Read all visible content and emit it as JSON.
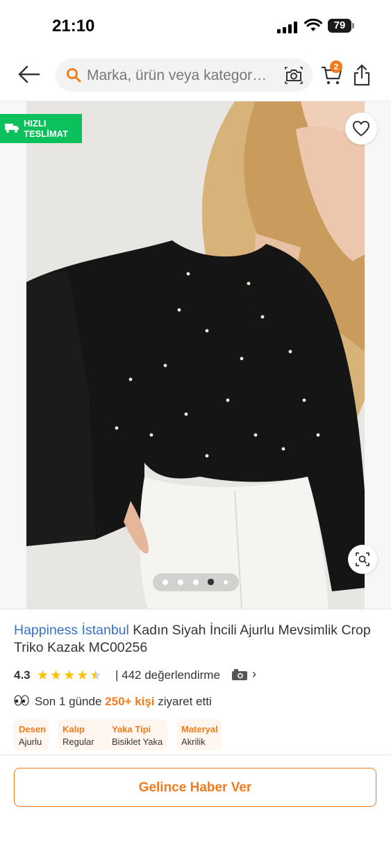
{
  "status_bar": {
    "time": "21:10",
    "battery": "79"
  },
  "nav": {
    "search_placeholder": "Marka, ürün veya kategor…",
    "cart_count": "2"
  },
  "hero": {
    "fast_delivery_badge": "HIZLI TESLİMAT",
    "gallery_index": 4,
    "gallery_total": 5
  },
  "product": {
    "brand": "Happiness İstanbul",
    "name": " Kadın Siyah İncili Ajurlu Mevsimlik Crop Triko Kazak MC00256",
    "rating": "4.3",
    "rating_value": 4.3,
    "reviews": "| 442 değerlendirme",
    "visits_prefix": "Son 1 günde ",
    "visits_highlight": "250+ kişi",
    "visits_suffix": " ziyaret etti"
  },
  "attributes": [
    {
      "key": "Desen",
      "value": "Ajurlu"
    },
    {
      "key": "Kalıp",
      "value": "Regular"
    },
    {
      "key": "Yaka Tipi",
      "value": "Bisiklet Yaka"
    },
    {
      "key": "Materyal",
      "value": "Akrilik"
    }
  ],
  "cta": {
    "label": "Gelince Haber Ver"
  },
  "colors": {
    "accent": "#f27a1a",
    "brand_link": "#3a6fc8",
    "badge_green": "#0bc15c",
    "star": "#ffc000"
  },
  "icons": [
    "back-arrow-icon",
    "search-icon",
    "camera-icon",
    "cart-icon",
    "share-icon",
    "truck-icon",
    "heart-icon",
    "zoom-search-icon",
    "eyes-icon",
    "camera-small-icon",
    "chevron-right-icon"
  ]
}
